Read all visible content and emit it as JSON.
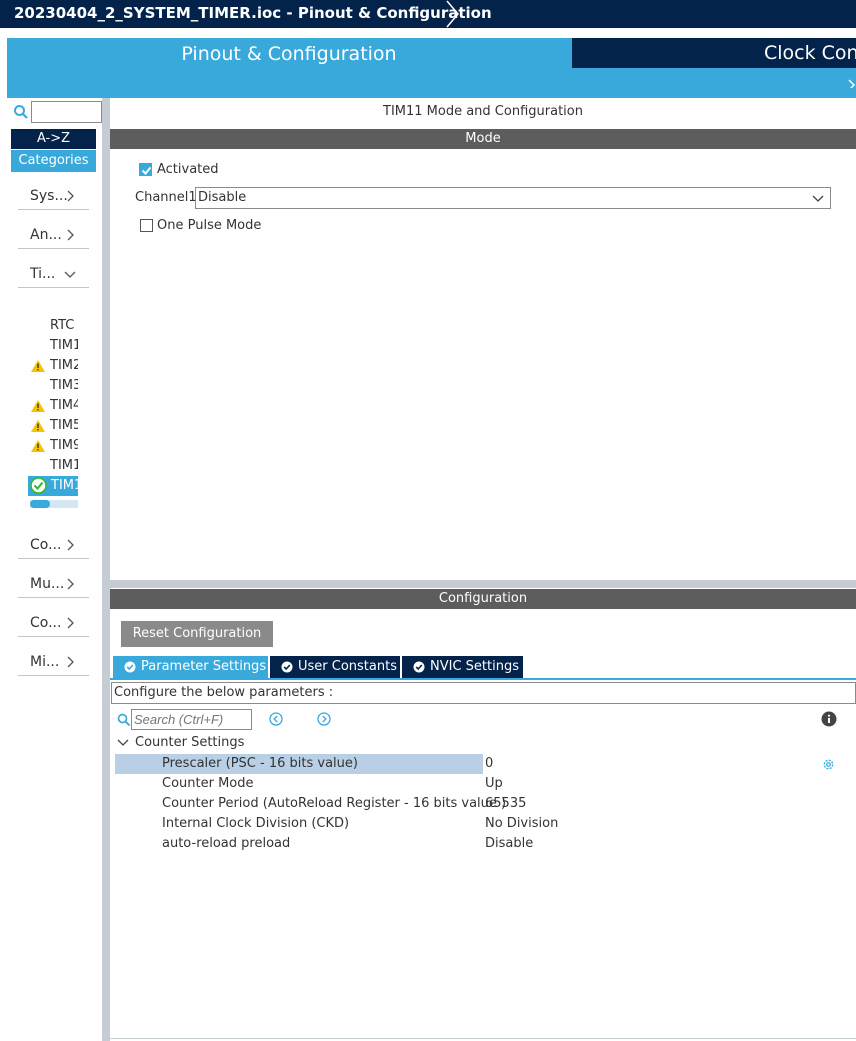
{
  "window": {
    "title": "20230404_2_SYSTEM_TIMER.ioc - Pinout & Configuration"
  },
  "tabs": {
    "pinout": "Pinout & Configuration",
    "clock": "Clock Configuration"
  },
  "sidebar": {
    "search_value": "",
    "az_label": "A->Z",
    "categories_label": "Categories",
    "categories": [
      {
        "label": "Sys..."
      },
      {
        "label": "An..."
      },
      {
        "label": "Ti..."
      },
      {
        "label": "Co..."
      },
      {
        "label": "Mu..."
      },
      {
        "label": "Co..."
      },
      {
        "label": "Mi..."
      }
    ],
    "timers": [
      {
        "label": "RTC",
        "status": "none"
      },
      {
        "label": "TIM1",
        "status": "none"
      },
      {
        "label": "TIM2",
        "status": "warning"
      },
      {
        "label": "TIM3",
        "status": "none"
      },
      {
        "label": "TIM4",
        "status": "warning"
      },
      {
        "label": "TIM5",
        "status": "warning"
      },
      {
        "label": "TIM9",
        "status": "warning"
      },
      {
        "label": "TIM1",
        "status": "none"
      },
      {
        "label": "TIM1",
        "status": "ok"
      }
    ]
  },
  "mode": {
    "panel_title": "TIM11 Mode and Configuration",
    "section_title": "Mode",
    "activated_label": "Activated",
    "activated_checked": true,
    "channel1_label": "Channel1",
    "channel1_value": "Disable",
    "one_pulse_label": "One Pulse Mode",
    "one_pulse_checked": false
  },
  "configuration": {
    "section_title": "Configuration",
    "reset_label": "Reset Configuration",
    "tabs": [
      {
        "label": "Parameter Settings",
        "active": true
      },
      {
        "label": "User Constants",
        "active": false
      },
      {
        "label": "NVIC Settings",
        "active": false
      }
    ],
    "description": "Configure the below parameters :",
    "search_placeholder": "Search (Ctrl+F)",
    "group_label": "Counter Settings",
    "params": [
      {
        "name": "Prescaler (PSC - 16 bits value)",
        "value": "0"
      },
      {
        "name": "Counter Mode",
        "value": "Up"
      },
      {
        "name": "Counter Period (AutoReload Register - 16 bits value )",
        "value": "65535"
      },
      {
        "name": "Internal Clock Division (CKD)",
        "value": "No Division"
      },
      {
        "name": "auto-reload preload",
        "value": "Disable"
      }
    ]
  },
  "colors": {
    "navy": "#03234b",
    "accent": "#39a9dc",
    "header_gray": "#5d5d5d",
    "warning": "#f5c400",
    "selection": "#b8cfe6"
  }
}
